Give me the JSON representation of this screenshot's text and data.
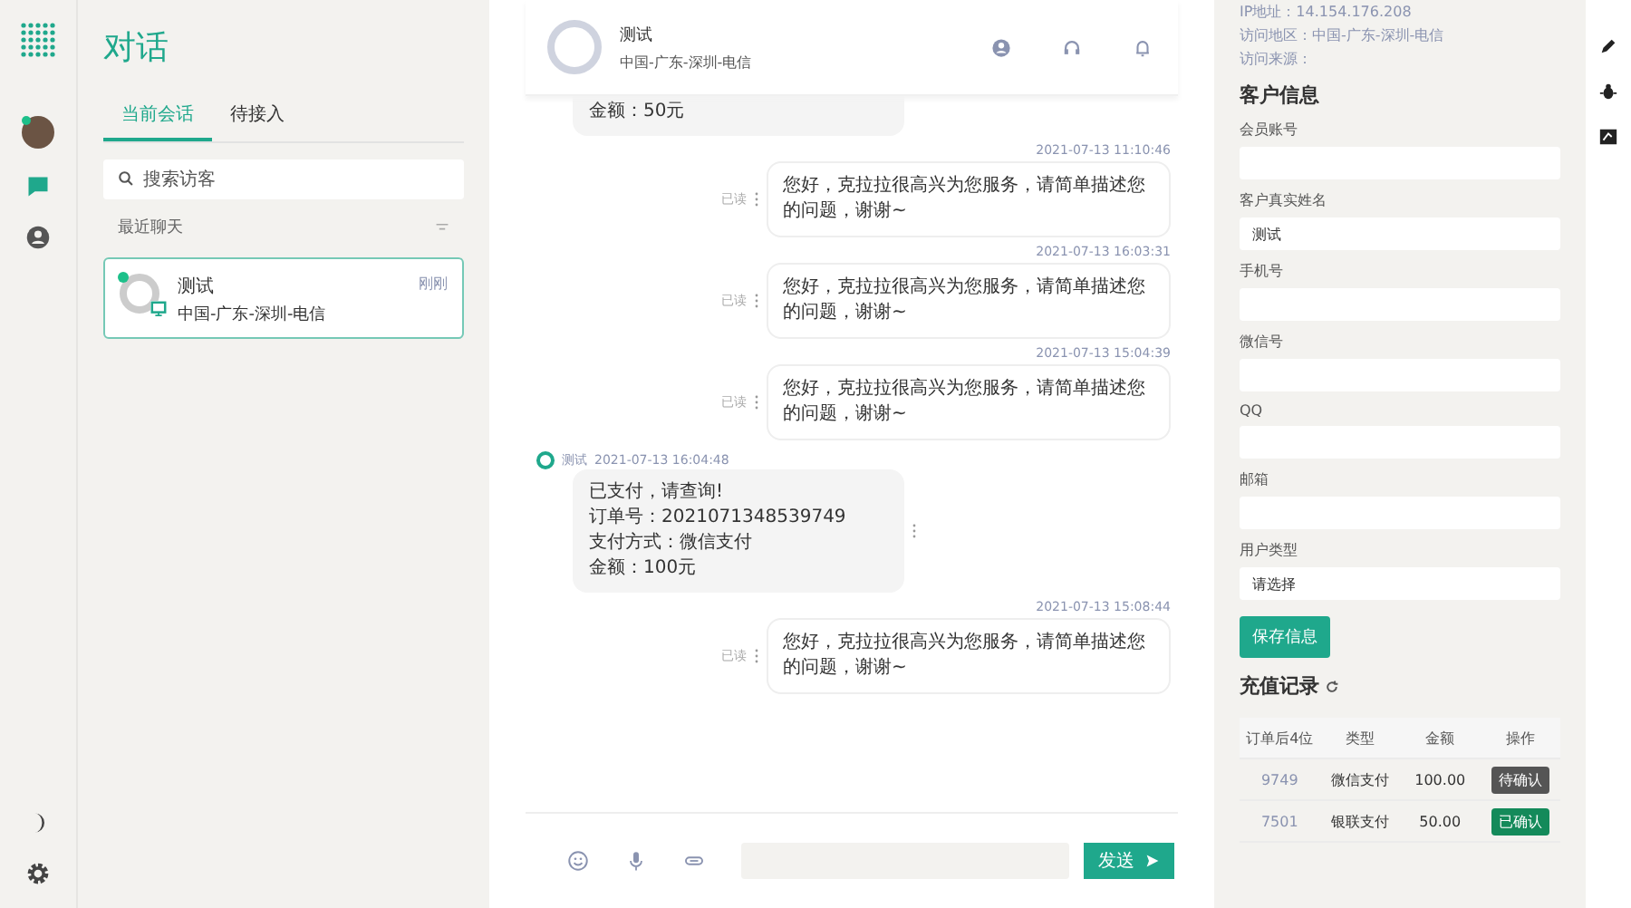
{
  "rail": {
    "items": [
      {
        "kind": "avatar",
        "selected": false,
        "online": true
      },
      {
        "kind": "chat",
        "selected": true
      },
      {
        "kind": "user",
        "selected": false
      }
    ]
  },
  "list_panel": {
    "title": "对话",
    "tabs": [
      {
        "label": "当前会话",
        "selected": true
      },
      {
        "label": "待接入",
        "selected": false
      }
    ],
    "search": {
      "placeholder": "搜索访客"
    },
    "section": "最近聊天",
    "conversations": [
      {
        "name": "测试",
        "location": "中国-广东-深圳-电信",
        "time": "刚刚",
        "online": true,
        "selected": true
      }
    ]
  },
  "chat": {
    "header": {
      "name": "测试",
      "location": "中国-广东-深圳-电信"
    },
    "messages": [
      {
        "kind": "in",
        "partial": true,
        "lines": [
          "金额：50元"
        ]
      },
      {
        "kind": "out",
        "time": "2021-07-13 11:10:46",
        "status": "已读",
        "lines": [
          "您好，克拉拉很高兴为您服务，请简单描述您的问题，谢谢~"
        ]
      },
      {
        "kind": "out",
        "time": "2021-07-13 16:03:31",
        "status": "已读",
        "lines": [
          "您好，克拉拉很高兴为您服务，请简单描述您的问题，谢谢~"
        ]
      },
      {
        "kind": "out",
        "time": "2021-07-13 15:04:39",
        "status": "已读",
        "lines": [
          "您好，克拉拉很高兴为您服务，请简单描述您的问题，谢谢~"
        ]
      },
      {
        "kind": "in",
        "sender": "测试",
        "time": "2021-07-13 16:04:48",
        "lines": [
          "已支付，请查询!",
          "订单号：2021071348539749",
          "支付方式：微信支付",
          "金额：100元"
        ]
      },
      {
        "kind": "out",
        "time": "2021-07-13 15:08:44",
        "status": "已读",
        "lines": [
          "您好，克拉拉很高兴为您服务，请简单描述您的问题，谢谢~"
        ]
      }
    ],
    "send_label": "发送"
  },
  "info_panel": {
    "visitor": [
      "IP地址：14.154.176.208",
      "访问地区：中国-广东-深圳-电信",
      "访问来源："
    ],
    "title": "客户信息",
    "fields": [
      {
        "label": "会员账号"
      },
      {
        "label": "客户真实姓名",
        "value": "测试"
      },
      {
        "label": "手机号"
      },
      {
        "label": "微信号"
      },
      {
        "label": "QQ"
      },
      {
        "label": "邮箱"
      },
      {
        "label": "用户类型",
        "value": "请选择"
      }
    ],
    "save_label": "保存信息",
    "records_title": "充值记录",
    "records": {
      "columns": [
        "订单后4位",
        "类型",
        "金额",
        "操作"
      ],
      "rows": [
        {
          "order": "9749",
          "type": "微信支付",
          "amount": "100.00",
          "action": "待确认",
          "confirmed": false
        },
        {
          "order": "7501",
          "type": "银联支付",
          "amount": "50.00",
          "action": "已确认",
          "confirmed": true
        }
      ]
    }
  }
}
